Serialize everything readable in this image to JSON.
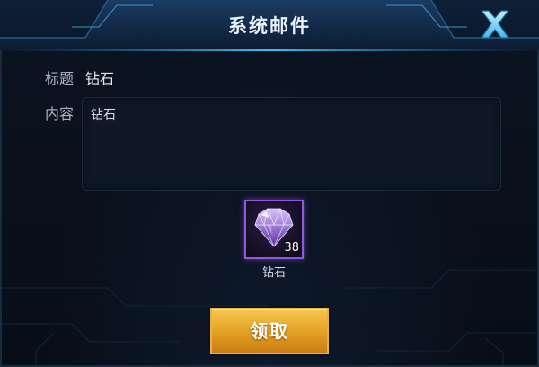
{
  "dialog": {
    "title": "系统邮件",
    "close_icon": "close-x-icon"
  },
  "mail": {
    "subject_label": "标题",
    "subject_value": "钻石",
    "content_label": "内容",
    "content_text": "钻石"
  },
  "attachment": {
    "icon": "diamond-icon",
    "count": "38",
    "name": "钻石",
    "rarity_color": "#9358d9"
  },
  "actions": {
    "claim_label": "领取"
  },
  "colors": {
    "accent": "#2fb2e8",
    "button": "#e9a730"
  }
}
